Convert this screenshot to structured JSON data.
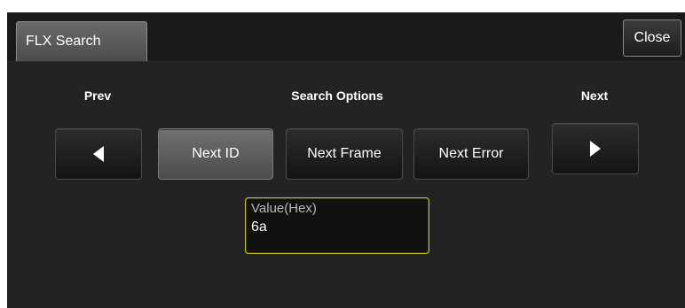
{
  "tab": {
    "label": "FLX Search"
  },
  "close": {
    "label": "Close"
  },
  "labels": {
    "prev": "Prev",
    "search_options": "Search Options",
    "next": "Next"
  },
  "buttons": {
    "next_id": "Next ID",
    "next_frame": "Next Frame",
    "next_error": "Next Error",
    "selected": "next_id"
  },
  "icons": {
    "prev": "triangle-left-icon",
    "next": "triangle-right-icon"
  },
  "value_field": {
    "caption": "Value(Hex)",
    "value": "6a",
    "border_color": "#c9c12a"
  }
}
